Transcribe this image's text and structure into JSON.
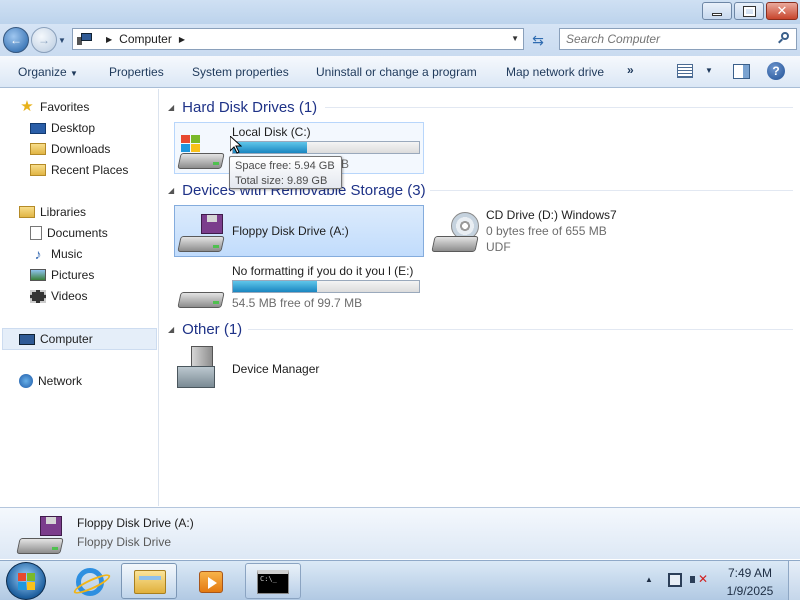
{
  "window": {
    "title_buttons": {
      "minimize_icon": "minimize-icon",
      "maximize_icon": "maximize-icon",
      "close_icon": "close-icon"
    }
  },
  "address": {
    "crumb": "Computer",
    "search_placeholder": "Search Computer"
  },
  "toolbar": {
    "organize": "Organize",
    "properties": "Properties",
    "system_properties": "System properties",
    "uninstall": "Uninstall or change a program",
    "map_drive": "Map network drive",
    "more": "»"
  },
  "navpane": {
    "favorites": "Favorites",
    "desktop": "Desktop",
    "downloads": "Downloads",
    "recent_places": "Recent Places",
    "libraries": "Libraries",
    "documents": "Documents",
    "music": "Music",
    "pictures": "Pictures",
    "videos": "Videos",
    "computer": "Computer",
    "network": "Network"
  },
  "groups": {
    "hdd": "Hard Disk Drives (1)",
    "removable": "Devices with Removable Storage (3)",
    "other": "Other (1)"
  },
  "drives": {
    "c": {
      "name": "Local Disk (C:)",
      "free_text_partial": "B",
      "used_fraction": 0.4
    },
    "a": {
      "name": "Floppy Disk Drive (A:)"
    },
    "d": {
      "name": "CD Drive (D:) Windows7",
      "free": "0 bytes free of 655 MB",
      "fs": "UDF"
    },
    "e": {
      "name": "No formatting if you do it you l (E:)",
      "free": "54.5 MB free of 99.7 MB",
      "used_fraction": 0.45
    },
    "devmgr": {
      "name": "Device Manager"
    }
  },
  "tooltip": {
    "space_free": "Space free: 5.94 GB",
    "total_size": "Total size: 9.89 GB"
  },
  "details": {
    "name": "Floppy Disk Drive (A:)",
    "type": "Floppy Disk Drive"
  },
  "taskbar": {
    "time": "7:49 AM",
    "date": "1/9/2025"
  },
  "colors": {
    "bar_fill": "#1a86c0",
    "group_header": "#1e3287",
    "selection": "#c1dcfc"
  }
}
